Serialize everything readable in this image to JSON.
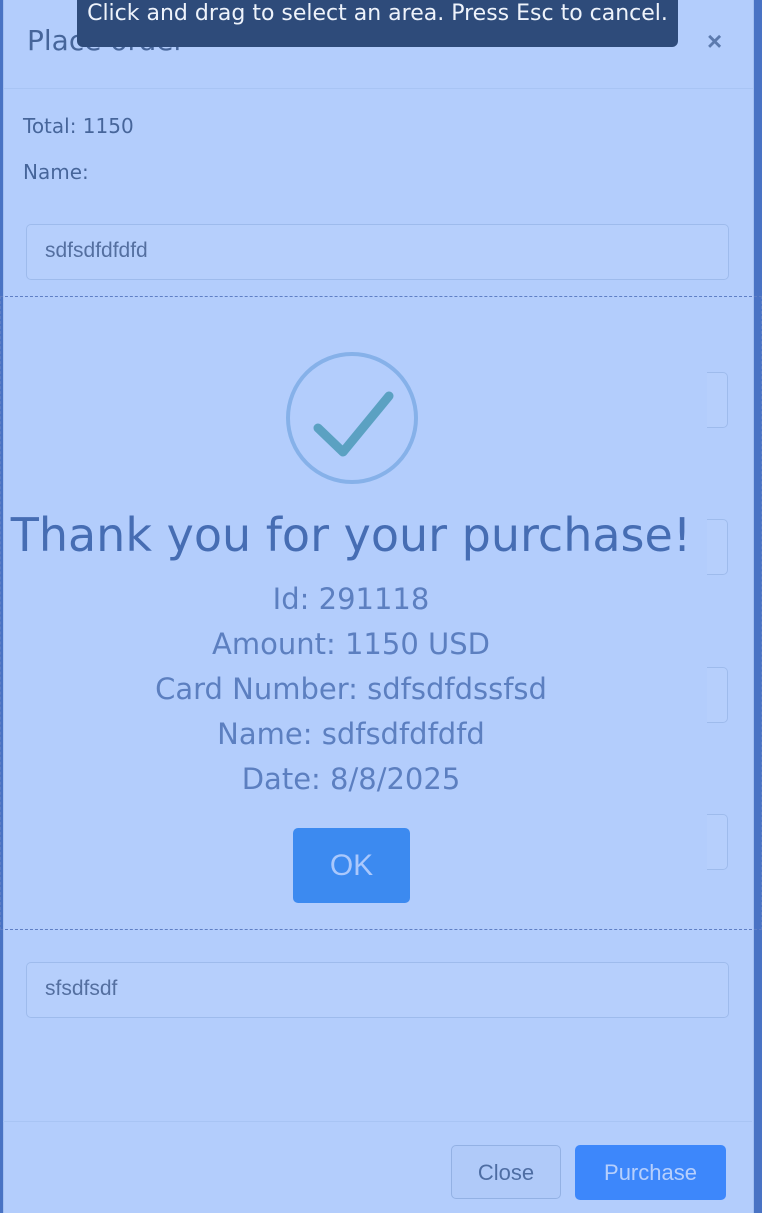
{
  "modal": {
    "title": "Place order",
    "close_icon": "×",
    "total_label": "Total: 1150",
    "name_label": "Name:",
    "name_value": "sdfsdfdfdfd",
    "last_field_value": "sfsdfsdf",
    "close_button": "Close",
    "purchase_button": "Purchase"
  },
  "hint": {
    "text": "Click and drag to select an area. Press Esc to cancel."
  },
  "alert": {
    "icon": "check-icon",
    "title": "Thank you for your purchase!",
    "id_line": "Id: 291118",
    "amount_line": "Amount: 1150 USD",
    "card_line": "Card Number: sdfsdfdssfsd",
    "name_line": "Name: sdfsdfdfdfd",
    "date_line": "Date: 8/8/2025",
    "ok_button": "OK"
  },
  "colors": {
    "primary": "#0d6efd",
    "check": "#49a38a",
    "overlay_tint": "#6ea0fa"
  }
}
